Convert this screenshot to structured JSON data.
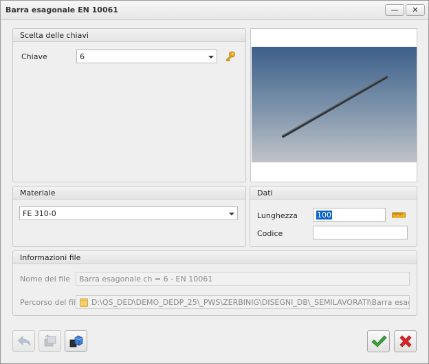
{
  "window": {
    "title": "Barra esagonale EN 10061",
    "minimize_glyph": "—",
    "close_glyph": "✕"
  },
  "keys_panel": {
    "title": "Scelta delle chiavi",
    "key_label": "Chiave",
    "key_value": "6",
    "key_icon": "key-icon"
  },
  "material_panel": {
    "title": "Materiale",
    "value": "FE 310-0"
  },
  "data_panel": {
    "title": "Dati",
    "length_label": "Lunghezza",
    "length_value": "100",
    "code_label": "Codice",
    "code_value": "",
    "ruler_icon": "ruler-icon"
  },
  "file_panel": {
    "title": "Informazioni file",
    "name_label": "Nome del file",
    "name_value": "Barra esagonale ch = 6 - EN 10061",
    "path_label": "Percorso del file",
    "path_value": "D:\\QS_DED\\DEMO_DEDP_25\\_PWS\\ZERBINIG\\DISEGNI_DB\\_SEMILAVORATI\\Barra esago...",
    "path_ellipsis": "···"
  },
  "toolbar": {
    "back_icon": "back-arrow-icon",
    "copy_icon": "copy-parts-icon",
    "3d_icon": "3d-cubes-icon",
    "ok_icon": "checkmark-icon",
    "cancel_icon": "cross-icon"
  },
  "colors": {
    "ok": "#3aa33a",
    "cancel": "#d9262b",
    "accent": "#0a64c8",
    "key": "#e8a317"
  }
}
